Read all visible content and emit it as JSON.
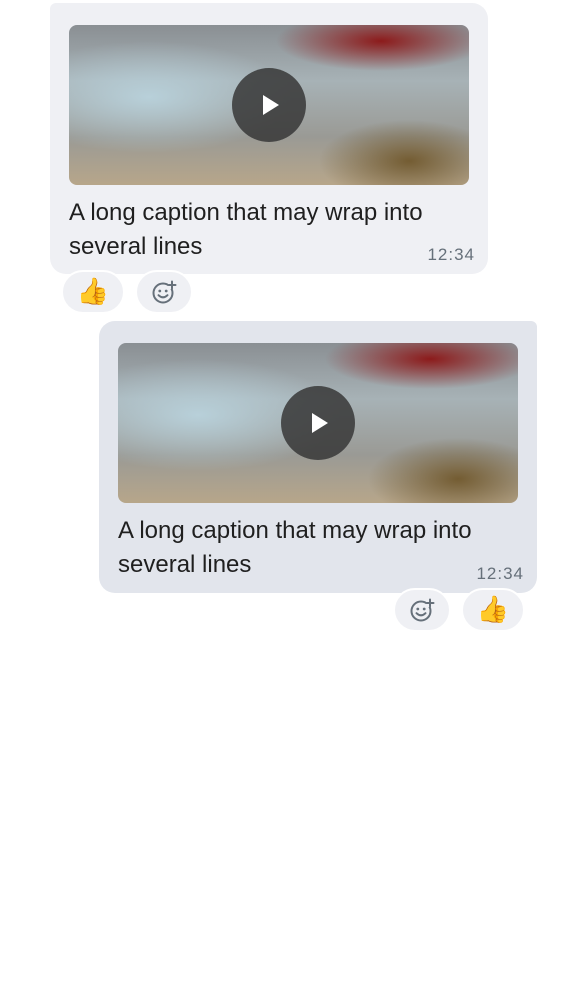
{
  "messages": [
    {
      "direction": "incoming",
      "caption": "A long caption that may wrap into several lines",
      "time": "12:34",
      "media": "video",
      "reactions": [
        {
          "type": "emoji",
          "emoji": "👍",
          "icon": "thumbs-up-icon"
        },
        {
          "type": "add",
          "icon": "add-reaction-icon"
        }
      ]
    },
    {
      "direction": "outgoing",
      "caption": "A long caption that may wrap into several lines",
      "time": "12:34",
      "media": "video",
      "reactions": [
        {
          "type": "add",
          "icon": "add-reaction-icon"
        },
        {
          "type": "emoji",
          "emoji": "👍",
          "icon": "thumbs-up-icon"
        }
      ]
    }
  ],
  "colors": {
    "incoming_bubble": "#eff0f4",
    "outgoing_bubble": "#e2e5ec",
    "timestamp": "#66707a",
    "text": "#1f1f1f"
  }
}
